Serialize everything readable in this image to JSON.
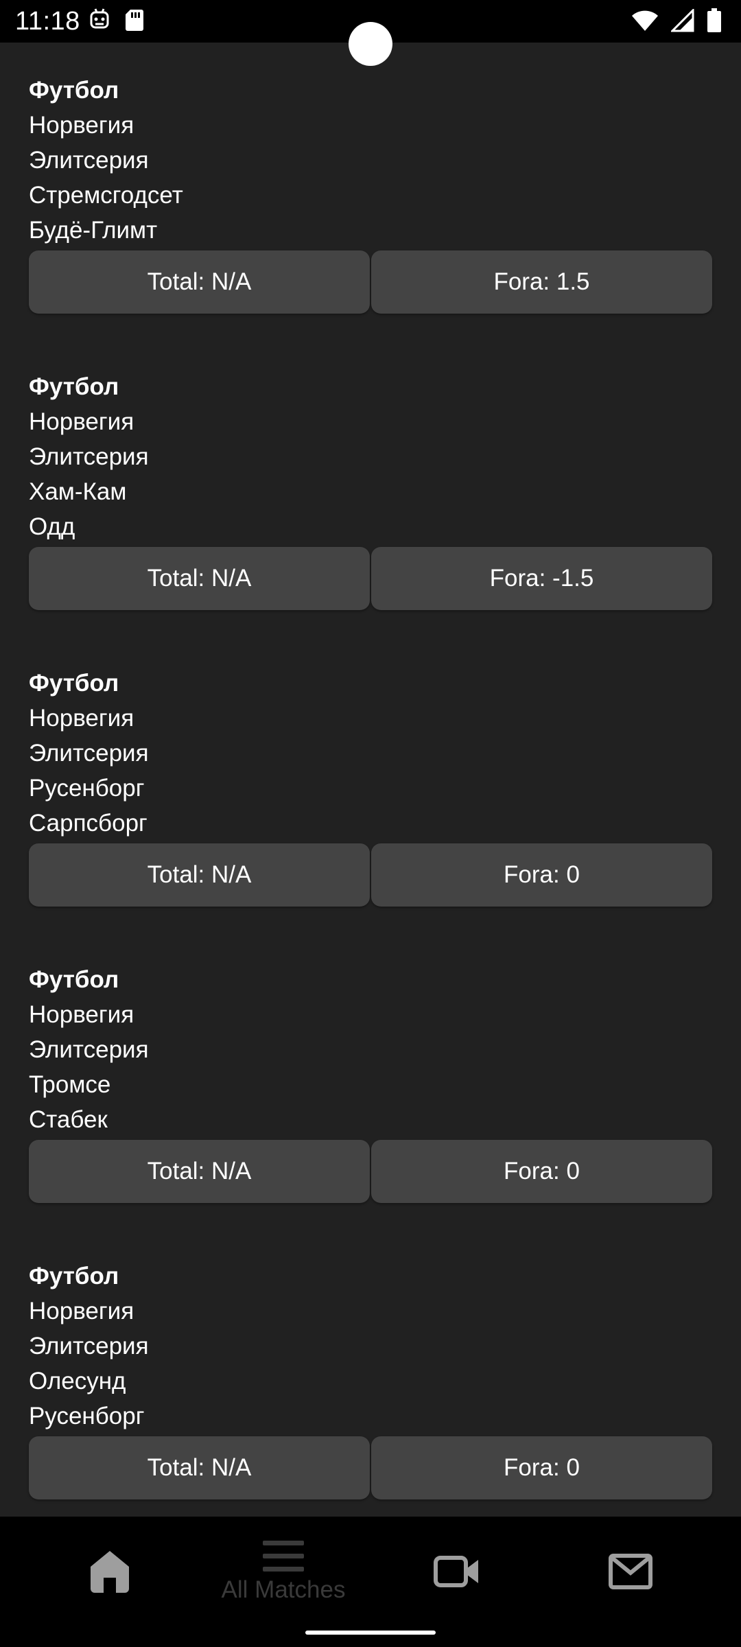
{
  "status_bar": {
    "time": "11:18",
    "left_icons": [
      "robot-icon",
      "sd-card-icon"
    ],
    "right_icons": [
      "wifi-icon",
      "signal-icon",
      "battery-icon"
    ]
  },
  "matches": [
    {
      "sport": "Футбол",
      "country": "Норвегия",
      "league": "Элитсерия",
      "team1": "Стремсгодсет",
      "team2": "Будё-Глимт",
      "total": "Total: N/A",
      "fora": "Fora: 1.5"
    },
    {
      "sport": "Футбол",
      "country": "Норвегия",
      "league": "Элитсерия",
      "team1": "Хам-Кам",
      "team2": "Одд",
      "total": "Total: N/A",
      "fora": "Fora: -1.5"
    },
    {
      "sport": "Футбол",
      "country": "Норвегия",
      "league": "Элитсерия",
      "team1": "Русенборг",
      "team2": "Сарпсборг",
      "total": "Total: N/A",
      "fora": "Fora: 0"
    },
    {
      "sport": "Футбол",
      "country": "Норвегия",
      "league": "Элитсерия",
      "team1": "Тромсе",
      "team2": "Стабек",
      "total": "Total: N/A",
      "fora": "Fora: 0"
    },
    {
      "sport": "Футбол",
      "country": "Норвегия",
      "league": "Элитсерия",
      "team1": "Олесунд",
      "team2": "Русенборг",
      "total": "Total: N/A",
      "fora": "Fora: 0"
    }
  ],
  "bottom_nav": {
    "items": [
      {
        "icon": "home-icon",
        "label": ""
      },
      {
        "icon": "menu-icon",
        "label": "All Matches"
      },
      {
        "icon": "video-camera-icon",
        "label": ""
      },
      {
        "icon": "mail-icon",
        "label": ""
      }
    ],
    "active_color": "#9e9e9e",
    "inactive_color": "#3a3a3a"
  }
}
